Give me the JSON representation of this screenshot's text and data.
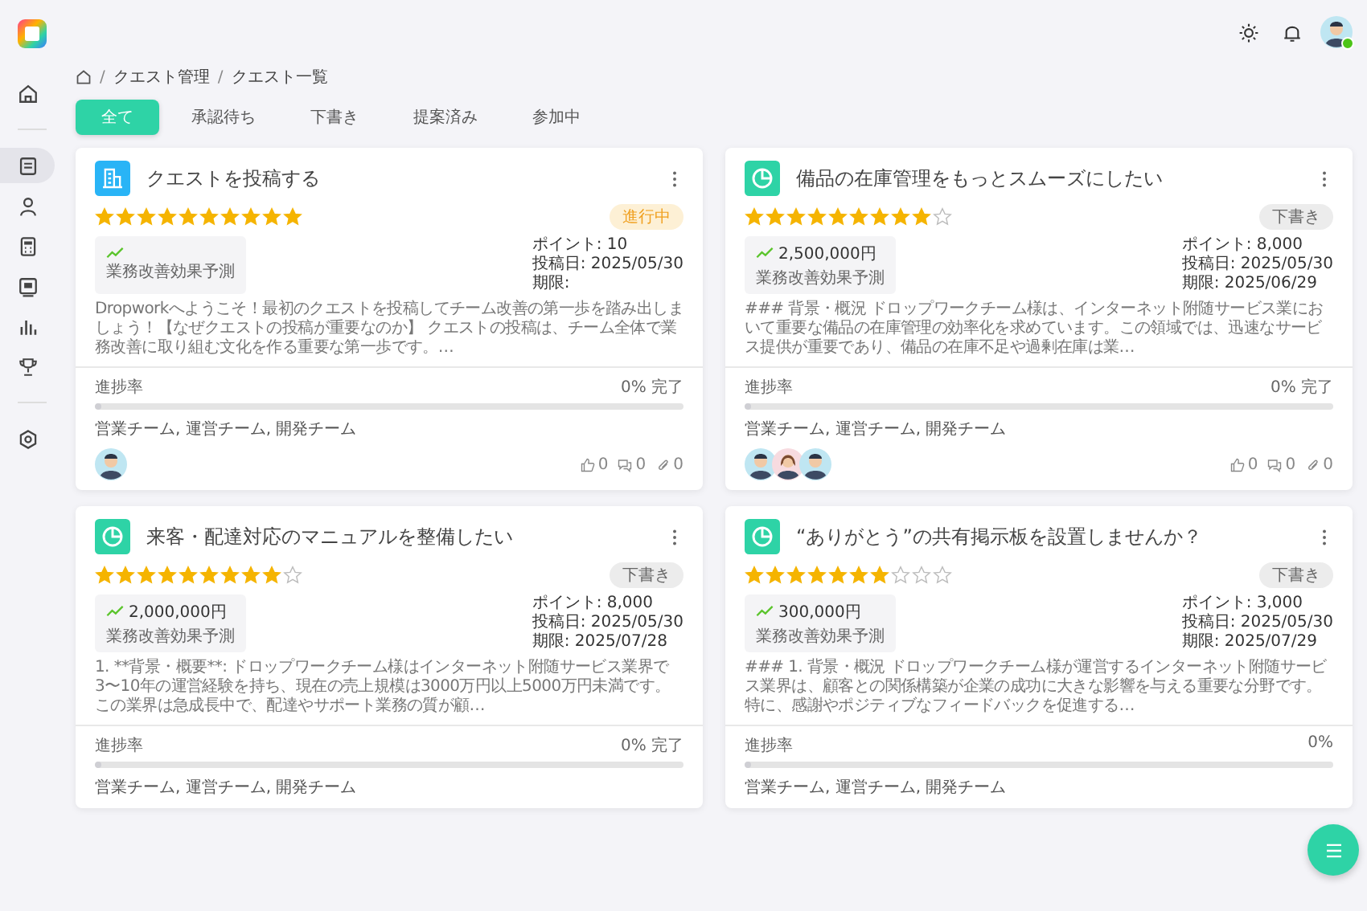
{
  "sidebar": {
    "items": [
      {
        "kind": "home",
        "selected": false
      },
      {
        "kind": "document",
        "selected": true
      },
      {
        "kind": "user",
        "selected": false
      },
      {
        "kind": "calculator",
        "selected": false
      },
      {
        "kind": "board",
        "selected": false
      },
      {
        "kind": "chart",
        "selected": false
      },
      {
        "kind": "trophy",
        "selected": false
      },
      {
        "kind": "settings",
        "selected": false
      }
    ]
  },
  "user": {
    "online": true
  },
  "breadcrumb": {
    "items": [
      "クエスト管理",
      "クエスト一覧"
    ],
    "separators": [
      "/",
      "/"
    ]
  },
  "tabs": [
    {
      "label": "全て",
      "selected": true
    },
    {
      "label": "承認待ち",
      "selected": false
    },
    {
      "label": "下書き",
      "selected": false
    },
    {
      "label": "提案済み",
      "selected": false
    },
    {
      "label": "参加中",
      "selected": false
    }
  ],
  "cards": [
    {
      "kind": "building",
      "title": "クエストを投稿する",
      "stars": 10,
      "status": {
        "label": "進行中",
        "kind": "active"
      },
      "impact_label": "業務改善効果予測",
      "points": "ポイント: 10",
      "posted": "投稿日: 2025/05/30",
      "deadline": "期限:",
      "description": "Dropworkへようこそ！最初のクエストを投稿してチーム改善の第一歩を踏み出しましょう！【なぜクエストの投稿が重要なのか】 クエストの投稿は、チーム全体で業務改善に取り組む文化を作る重要な第一歩です。…",
      "progress": {
        "label": "進捗率",
        "level": 0,
        "reading": "0% 完了"
      },
      "teams": "営業チーム, 運営チーム, 開発チーム",
      "avatars": [
        {
          "kind": "man"
        }
      ],
      "stats": [
        {
          "kind": "like",
          "value": "0"
        },
        {
          "kind": "comment",
          "value": "0"
        },
        {
          "kind": "attachment",
          "value": "0"
        }
      ]
    },
    {
      "kind": "pie",
      "title": "備品の在庫管理をもっとスムーズにしたい",
      "stars": 9,
      "status": {
        "label": "下書き",
        "kind": "draft"
      },
      "amount": "2,500,000円",
      "impact_label": "業務改善効果予測",
      "points": "ポイント: 8,000",
      "posted": "投稿日: 2025/05/30",
      "deadline": "期限: 2025/06/29",
      "description": "### 背景・概況 ドロップワークチーム様は、インターネット附随サービス業において重要な備品の在庫管理の効率化を求めています。この領域では、迅速なサービス提供が重要であり、備品の在庫不足や過剰在庫は業…",
      "progress": {
        "label": "進捗率",
        "level": 0,
        "reading": "0% 完了"
      },
      "teams": "営業チーム, 運営チーム, 開発チーム",
      "avatars": [
        {
          "kind": "man"
        },
        {
          "kind": "woman"
        },
        {
          "kind": "man"
        }
      ],
      "stats": [
        {
          "kind": "like",
          "value": "0"
        },
        {
          "kind": "comment",
          "value": "0"
        },
        {
          "kind": "attachment",
          "value": "0"
        }
      ]
    },
    {
      "kind": "pie",
      "title": "来客・配達対応のマニュアルを整備したい",
      "stars": 9,
      "status": {
        "label": "下書き",
        "kind": "draft"
      },
      "amount": "2,000,000円",
      "impact_label": "業務改善効果予測",
      "points": "ポイント: 8,000",
      "posted": "投稿日: 2025/05/30",
      "deadline": "期限: 2025/07/28",
      "description": "1. **背景・概要**: ドロップワークチーム様はインターネット附随サービス業界で3〜10年の運営経験を持ち、現在の売上規模は3000万円以上5000万円未満です。この業界は急成長中で、配達やサポート業務の質が顧…",
      "progress": {
        "label": "進捗率",
        "level": 0,
        "reading": "0% 完了"
      },
      "teams": "営業チーム, 運営チーム, 開発チーム"
    },
    {
      "kind": "pie",
      "title": "“ありがとう”の共有掲示板を設置しませんか？",
      "stars": 7,
      "status": {
        "label": "下書き",
        "kind": "draft"
      },
      "amount": "300,000円",
      "impact_label": "業務改善効果予測",
      "points": "ポイント: 3,000",
      "posted": "投稿日: 2025/05/30",
      "deadline": "期限: 2025/07/29",
      "description": "### 1. 背景・概況 ドロップワークチーム様が運営するインターネット附随サービス業界は、顧客との関係構築が企業の成功に大きな影響を与える重要な分野です。特に、感謝やポジティブなフィードバックを促進する…",
      "progress": {
        "label": "進捗率",
        "level": 0,
        "reading": "0%"
      },
      "teams": "営業チーム, 運営チーム, 開発チーム"
    }
  ]
}
